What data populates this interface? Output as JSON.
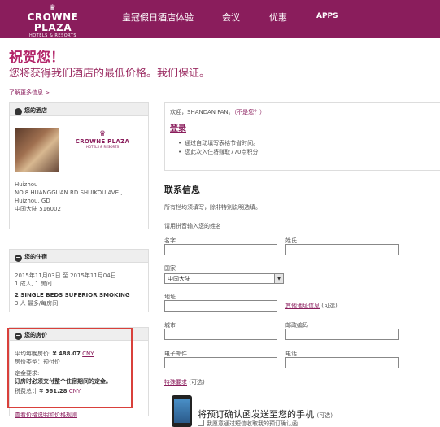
{
  "nav": {
    "logo_brand": "CROWNE PLAZA",
    "logo_sub": "HOTELS & RESORTS",
    "items": [
      "皇冠假日酒店体验",
      "会议",
      "优惠",
      "APPS"
    ]
  },
  "headline": "祝贺您！",
  "subhead": "您将获得我们酒店的最低价格。我们保证。",
  "learn_more": "了解更多信息 >",
  "hotel": {
    "header": "您的酒店",
    "logo_brand": "CROWNE PLAZA",
    "logo_sub": "HOTELS & RESORTS",
    "city": "Huizhou",
    "address1": "NO.8 HUANGGUAN RD SHUIKOU AVE.,",
    "address2": "Huizhou, GD",
    "address3": "中国大陆   516002"
  },
  "stay": {
    "header": "您的住宿",
    "dates": "2015年11月03日 至 2015年11月04日",
    "guests": "1 成人, 1 房间",
    "room": "2 SINGLE BEDS SUPERIOR SMOKING",
    "occupancy": "3 人 最多/每房间"
  },
  "price": {
    "header": "您的房价",
    "avg_label": "平均每晚房价:",
    "avg_value": "¥ 488.07",
    "currency": "CNY",
    "type_label": "房价类型：",
    "type_value": "预付价",
    "deposit_label": "定金要求:",
    "deposit_text": "订房时必须交付整个住宿期间的定金。",
    "total_label": "税费总计",
    "total_value": "¥ 561.28",
    "view_rules": "查看价格说明和价格规则"
  },
  "welcome": {
    "text": "欢迎，SHANDAN FAN。",
    "not_you": "（不是您？）",
    "login": "登录",
    "benefits": [
      "通过自动填写表格节省时间。",
      "您此次入住将赚取770点积分"
    ]
  },
  "contact": {
    "title": "联系信息",
    "required_note": "所有栏均须填写，除非特别说明选填。",
    "name_note": "请用拼音输入您的姓名",
    "first_name": "名字",
    "last_name": "姓氏",
    "country_label": "国家",
    "country_value": "中国大陆",
    "address_label": "地址",
    "other_address": "其他地址信息",
    "optional": "(可选)",
    "city_label": "城市",
    "postcode_label": "邮政编码",
    "email_label": "电子邮件",
    "phone_label": "电话",
    "special_req": "特殊要求"
  },
  "sms": {
    "title": "将预订确认函发送至您的手机",
    "optional": "(可选)",
    "checkbox_label": "我愿意通过短信收取我的预订确认函"
  }
}
